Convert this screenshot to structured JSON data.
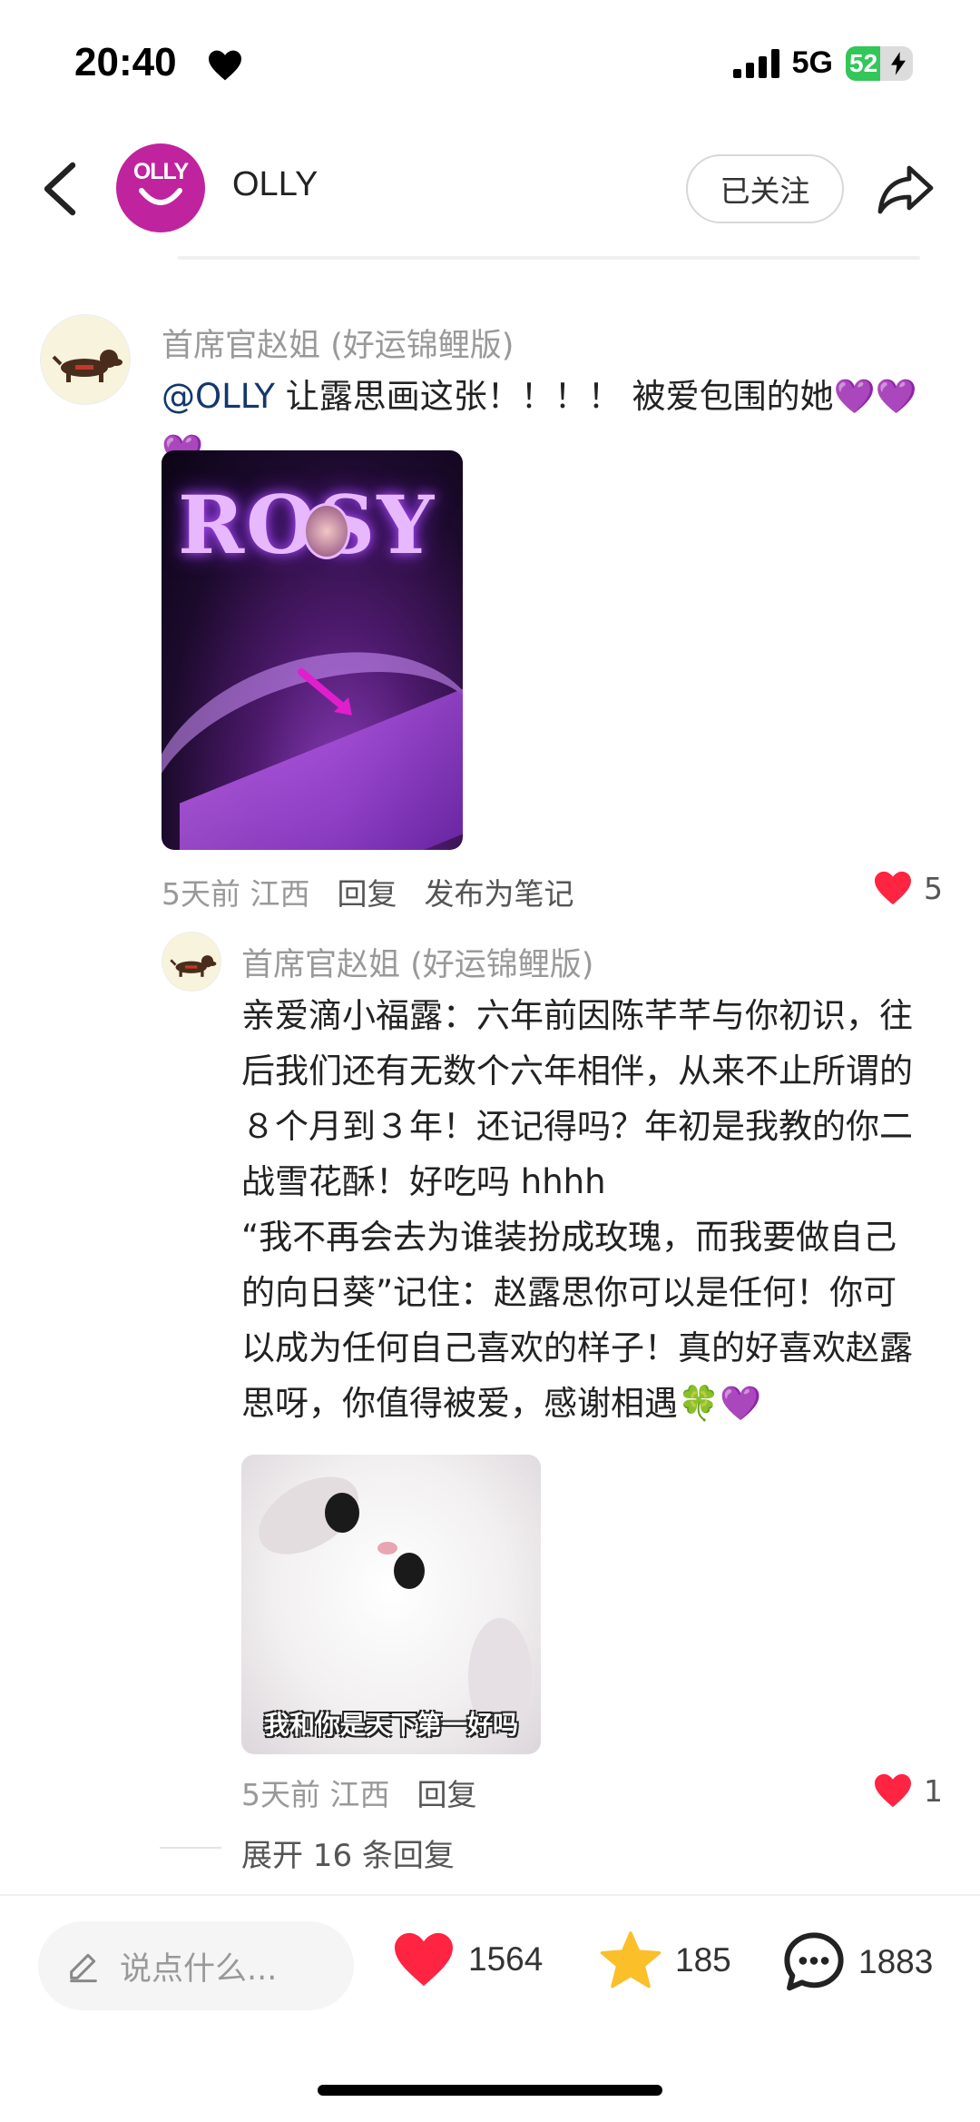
{
  "status_bar": {
    "time": "20:40",
    "network": "5G",
    "battery": "52",
    "battery_level": 0.52
  },
  "header": {
    "title": "OLLY",
    "avatar_logo_text": "OLLY",
    "follow_label": "已关注"
  },
  "comment": {
    "username": "首席官赵姐 (好运锦鲤版)",
    "mention": "@OLLY",
    "text": " 让露思画这张！！！！ 被爱包围的她💜💜💜",
    "image_overlay_text": "ROSY",
    "time": "5天前",
    "location": "江西",
    "reply_label": "回复",
    "publish_label": "发布为笔记",
    "likes": "5"
  },
  "reply": {
    "username": "首席官赵姐 (好运锦鲤版)",
    "text_lines": [
      "亲爱滴小福露：六年前因陈芊芊与你初识，往",
      "后我们还有无数个六年相伴，从来不止所谓的",
      "８个月到３年！还记得吗？年初是我教的你二",
      "战雪花酥！好吃吗 hhhh",
      "“我不再会去为谁装扮成玫瑰，而我要做自己",
      "的向日葵”记住：赵露思你可以是任何！你可",
      "以成为任何自己喜欢的样子！真的好喜欢赵露",
      "思呀，你值得被爱，感谢相遇🍀💜"
    ],
    "image_caption": "我和你是天下第一好吗",
    "time": "5天前",
    "location": "江西",
    "reply_label": "回复",
    "likes": "1"
  },
  "expand": {
    "label": "展开 16 条回复"
  },
  "bottom_bar": {
    "input_placeholder": "说点什么...",
    "likes": "1564",
    "stars": "185",
    "comments": "1883"
  },
  "colors": {
    "like_red": "#ff2442",
    "star_yellow": "#fbbf2a",
    "mention_blue": "#13386c",
    "brand_magenta": "#c0239e"
  }
}
